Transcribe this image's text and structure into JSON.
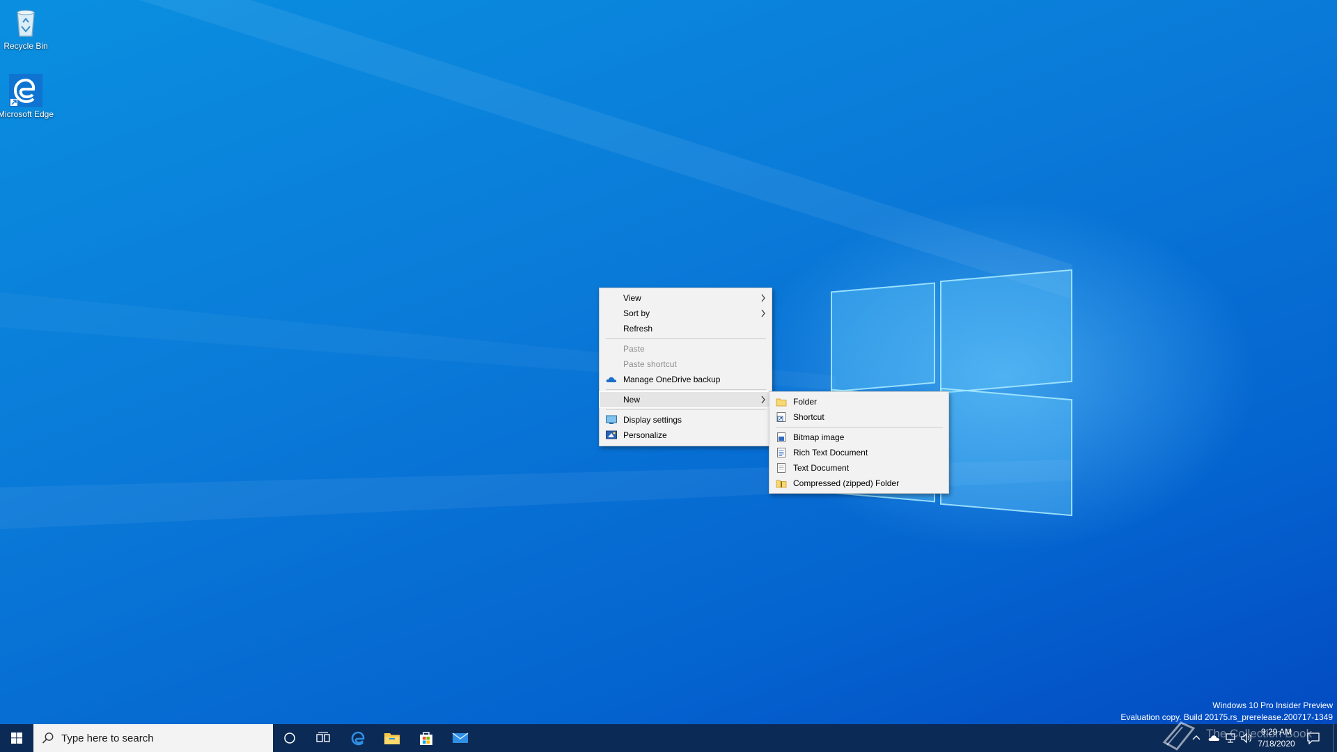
{
  "desktop": {
    "icons": [
      {
        "label": "Recycle Bin"
      },
      {
        "label": "Microsoft Edge"
      }
    ]
  },
  "context_menu": {
    "items": [
      {
        "label": "View",
        "submenu": true
      },
      {
        "label": "Sort by",
        "submenu": true
      },
      {
        "label": "Refresh"
      },
      {
        "label": "Paste",
        "disabled": true
      },
      {
        "label": "Paste shortcut",
        "disabled": true
      },
      {
        "label": "Manage OneDrive backup",
        "icon": "onedrive-cloud-icon"
      },
      {
        "label": "New",
        "submenu": true,
        "active": true
      },
      {
        "label": "Display settings",
        "icon": "display-icon"
      },
      {
        "label": "Personalize",
        "icon": "personalize-icon"
      }
    ]
  },
  "new_submenu": {
    "items": [
      {
        "label": "Folder",
        "icon": "folder-icon"
      },
      {
        "label": "Shortcut",
        "icon": "shortcut-icon"
      },
      {
        "label": "Bitmap image",
        "icon": "bitmap-icon"
      },
      {
        "label": "Rich Text Document",
        "icon": "rich-text-icon"
      },
      {
        "label": "Text Document",
        "icon": "text-document-icon"
      },
      {
        "label": "Compressed (zipped) Folder",
        "icon": "zip-folder-icon"
      }
    ]
  },
  "watermark": {
    "line1": "Windows 10 Pro Insider Preview",
    "line2": "Evaluation copy. Build 20175.rs_prerelease.200717-1349"
  },
  "taskbar": {
    "search_placeholder": "Type here to search",
    "clock_time": "9:29 AM",
    "clock_date": "7/18/2020",
    "overlay_text": "The Collection Book"
  },
  "colors": {
    "taskbar": "#0c2a56",
    "menu_bg": "#f2f2f2",
    "desktop_accent": "#0a7ad8"
  }
}
